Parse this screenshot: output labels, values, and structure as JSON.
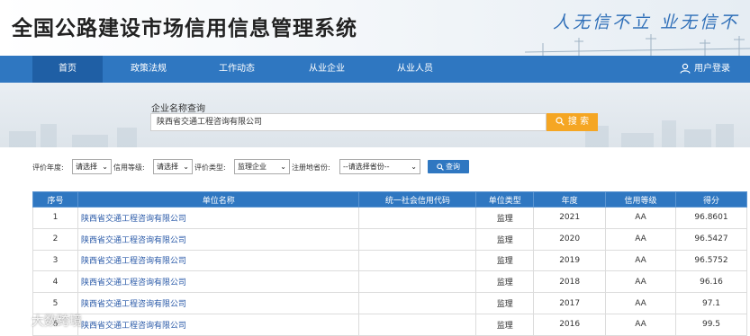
{
  "header": {
    "title": "全国公路建设市场信用信息管理系统",
    "slogan": "人无信不立 业无信不"
  },
  "nav": {
    "items": [
      {
        "label": "首页"
      },
      {
        "label": "政策法规"
      },
      {
        "label": "工作动态"
      },
      {
        "label": "从业企业"
      },
      {
        "label": "从业人员"
      }
    ],
    "login_label": "用户登录"
  },
  "search": {
    "label": "企业名称查询",
    "value": "陕西省交通工程咨询有限公司",
    "button_label": "搜 索"
  },
  "filters": {
    "year_label": "评价年度:",
    "year_value": "请选择",
    "grade_label": "信用等级:",
    "grade_value": "请选择",
    "type_label": "评价类型:",
    "type_value": "监理企业",
    "province_label": "注册地省份:",
    "province_value": "--请选择省份--",
    "query_label": "查询"
  },
  "table": {
    "headers": [
      "序号",
      "单位名称",
      "统一社会信用代码",
      "单位类型",
      "年度",
      "信用等级",
      "得分"
    ],
    "rows": [
      {
        "no": "1",
        "name": "陕西省交通工程咨询有限公司",
        "code": "",
        "type": "监理",
        "year": "2021",
        "grade": "AA",
        "score": "96.8601"
      },
      {
        "no": "2",
        "name": "陕西省交通工程咨询有限公司",
        "code": "",
        "type": "监理",
        "year": "2020",
        "grade": "AA",
        "score": "96.5427"
      },
      {
        "no": "3",
        "name": "陕西省交通工程咨询有限公司",
        "code": "",
        "type": "监理",
        "year": "2019",
        "grade": "AA",
        "score": "96.5752"
      },
      {
        "no": "4",
        "name": "陕西省交通工程咨询有限公司",
        "code": "",
        "type": "监理",
        "year": "2018",
        "grade": "AA",
        "score": "96.16"
      },
      {
        "no": "5",
        "name": "陕西省交通工程咨询有限公司",
        "code": "",
        "type": "监理",
        "year": "2017",
        "grade": "AA",
        "score": "97.1"
      },
      {
        "no": "6",
        "name": "陕西省交通工程咨询有限公司",
        "code": "",
        "type": "监理",
        "year": "2016",
        "grade": "AA",
        "score": "99.5"
      }
    ]
  },
  "watermark": {
    "text": "大数跨境"
  },
  "colors": {
    "nav_blue": "#2f77c1",
    "search_orange": "#f5a623",
    "slogan_blue": "#2f6fb8"
  }
}
